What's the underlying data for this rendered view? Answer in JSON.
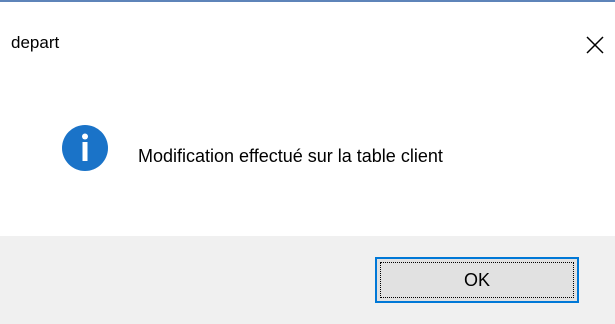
{
  "dialog": {
    "title": "depart",
    "message": "Modification effectué sur la table client",
    "ok_label": "OK"
  },
  "icons": {
    "close": "close-icon",
    "info": "information-icon"
  },
  "colors": {
    "accent": "#0078d7",
    "info_icon": "#1a73c8",
    "footer_bg": "#f0f0f0",
    "button_bg": "#e1e1e1",
    "title_border": "#5e84b9"
  }
}
